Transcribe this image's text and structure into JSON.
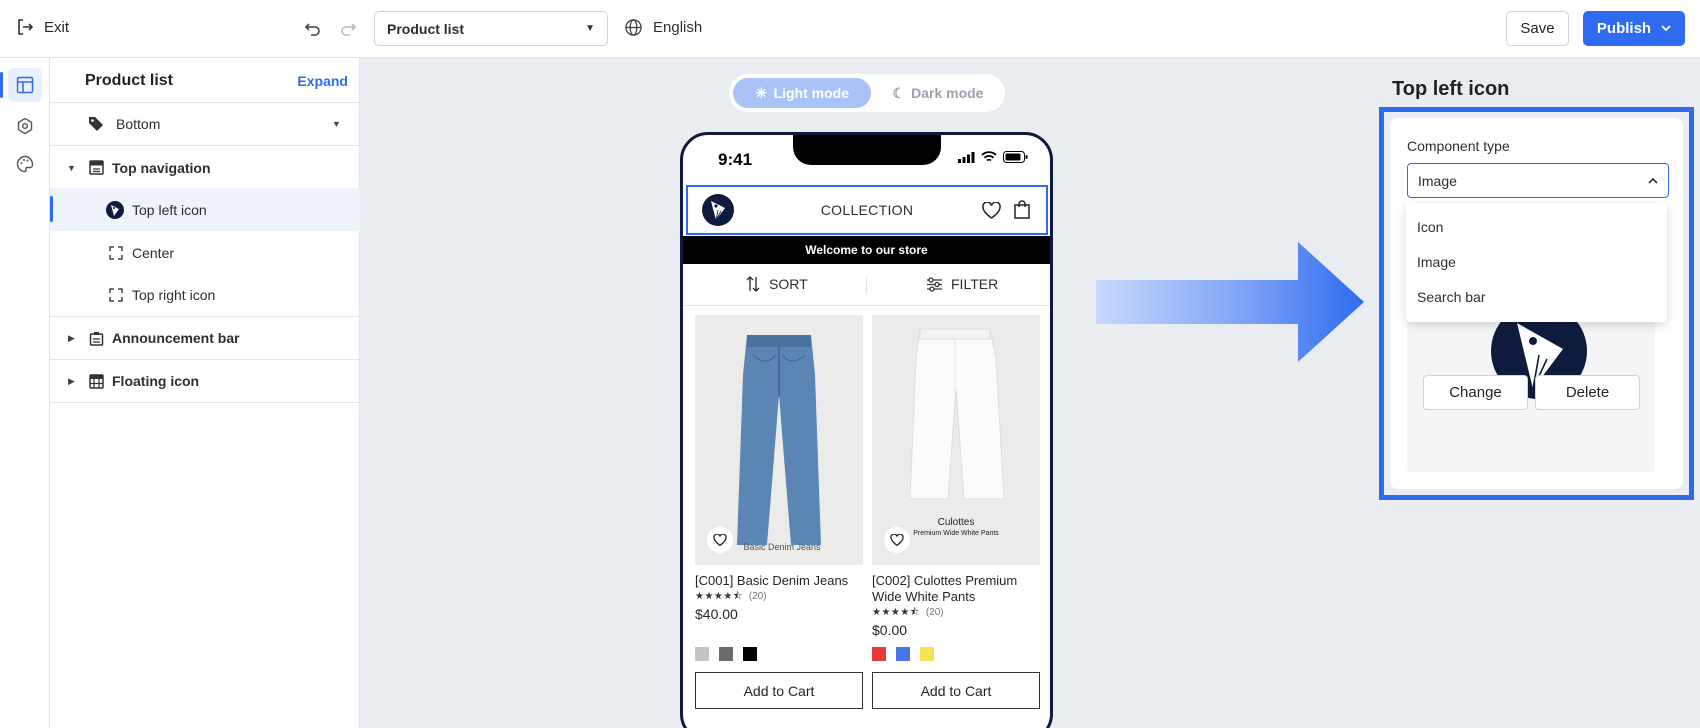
{
  "topbar": {
    "exit_label": "Exit",
    "page_select": "Product list",
    "language": "English",
    "save_label": "Save",
    "publish_label": "Publish"
  },
  "panel": {
    "title": "Product list",
    "expand_label": "Expand",
    "items": [
      {
        "label": "Bottom"
      },
      {
        "label": "Top navigation"
      },
      {
        "label": "Top left icon"
      },
      {
        "label": "Center"
      },
      {
        "label": "Top right icon"
      },
      {
        "label": "Announcement bar"
      },
      {
        "label": "Floating icon"
      }
    ]
  },
  "mode_toggle": {
    "light": "Light mode",
    "dark": "Dark mode"
  },
  "phone": {
    "time": "9:41",
    "collection": "COLLECTION",
    "announcement": "Welcome to our store",
    "sort": "SORT",
    "filter": "FILTER",
    "products": [
      {
        "name": "[C001] Basic Denim Jeans",
        "rating_count": "(20)",
        "price": "$40.00",
        "image_caption": "Basic Denim Jeans",
        "swatches": [
          "#c4c4c4",
          "#6b6b6b",
          "#000000"
        ],
        "add_to_cart": "Add to Cart"
      },
      {
        "name": "[C002] Culottes Premium Wide White Pants",
        "rating_count": "(20)",
        "price": "$0.00",
        "image_caption_1": "Culottes",
        "image_caption_2": "Premium Wide White Pants",
        "swatches": [
          "#e83a3a",
          "#4a74e8",
          "#f5e352"
        ],
        "add_to_cart": "Add to Cart"
      }
    ]
  },
  "settings": {
    "title": "Top left icon",
    "component_type_label": "Component type",
    "component_type_value": "Image",
    "options": [
      "Icon",
      "Image",
      "Search bar"
    ],
    "change_label": "Change",
    "delete_label": "Delete"
  },
  "colors": {
    "accent": "#2e6bf0",
    "canvas_bg": "#e9ecf1",
    "phone_frame": "#0e1b3d"
  }
}
